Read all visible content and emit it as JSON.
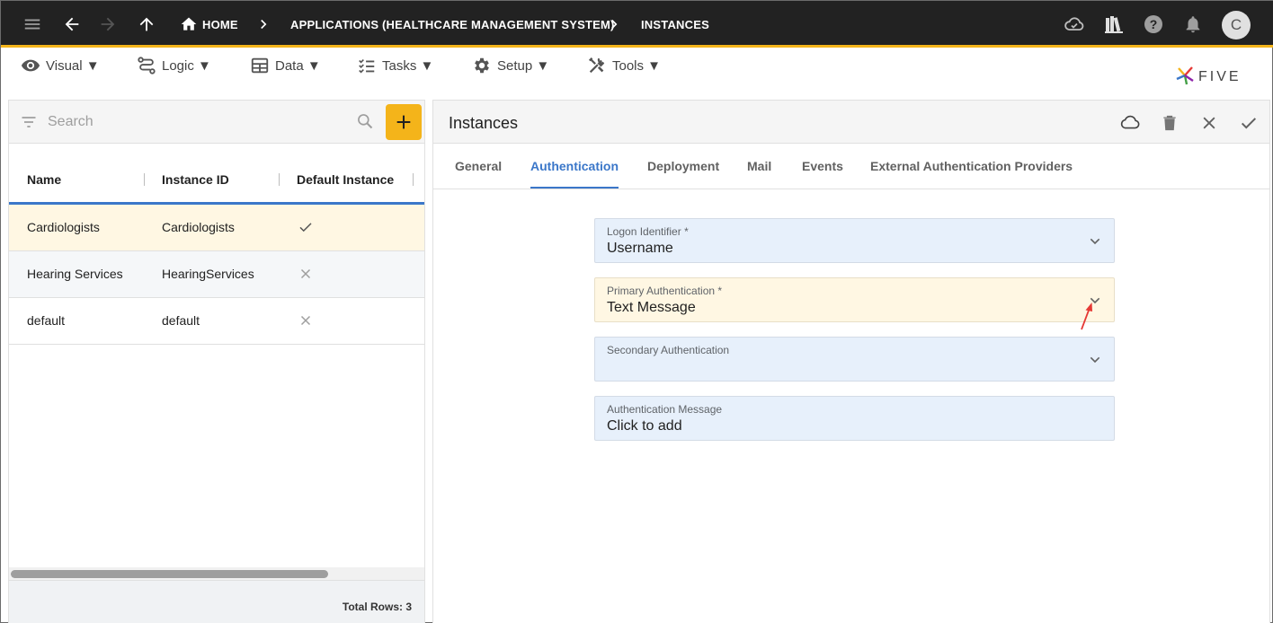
{
  "topbar": {
    "breadcrumbs": [
      "HOME",
      "APPLICATIONS (HEALTHCARE MANAGEMENT SYSTEM)",
      "INSTANCES"
    ],
    "avatar_initial": "C",
    "icons": [
      "menu-icon",
      "back-icon",
      "forward-icon",
      "up-icon",
      "home-icon",
      "cloud-sync-icon",
      "library-icon",
      "help-icon",
      "bell-icon"
    ]
  },
  "menubar": {
    "items": [
      "Visual ▼",
      "Logic ▼",
      "Data ▼",
      "Tasks ▼",
      "Setup ▼",
      "Tools ▼"
    ]
  },
  "logo": {
    "text": "FIVE"
  },
  "list": {
    "search_placeholder": "Search",
    "columns": [
      "Name",
      "Instance ID",
      "Default Instance"
    ],
    "rows": [
      {
        "name": "Cardiologists",
        "instance_id": "Cardiologists",
        "default": true,
        "selected": true
      },
      {
        "name": "Hearing Services",
        "instance_id": "HearingServices",
        "default": false,
        "selected": false
      },
      {
        "name": "default",
        "instance_id": "default",
        "default": false,
        "selected": false
      }
    ],
    "total_rows": "Total Rows: 3"
  },
  "form": {
    "title": "Instances",
    "tabs": [
      "General",
      "Authentication",
      "Deployment",
      "Mail",
      "Events",
      "External Authentication Providers"
    ],
    "active_tab": "Authentication",
    "fields": [
      {
        "label": "Logon Identifier *",
        "value": "Username",
        "type": "select"
      },
      {
        "label": "Primary Authentication *",
        "value": "Text Message",
        "type": "select"
      },
      {
        "label": "Secondary Authentication",
        "value": "",
        "type": "select"
      },
      {
        "label": "Authentication Message",
        "value": "Click to add",
        "type": "text"
      }
    ]
  },
  "colors": {
    "accent": "#f4b41a",
    "topbar": "#222222",
    "tab_active": "#3b77c9",
    "field_bg": "#e7f0fb",
    "field_highlight": "#fff7e3",
    "selected_row": "#fff7e3",
    "annotation_arrow": "#e53935"
  }
}
